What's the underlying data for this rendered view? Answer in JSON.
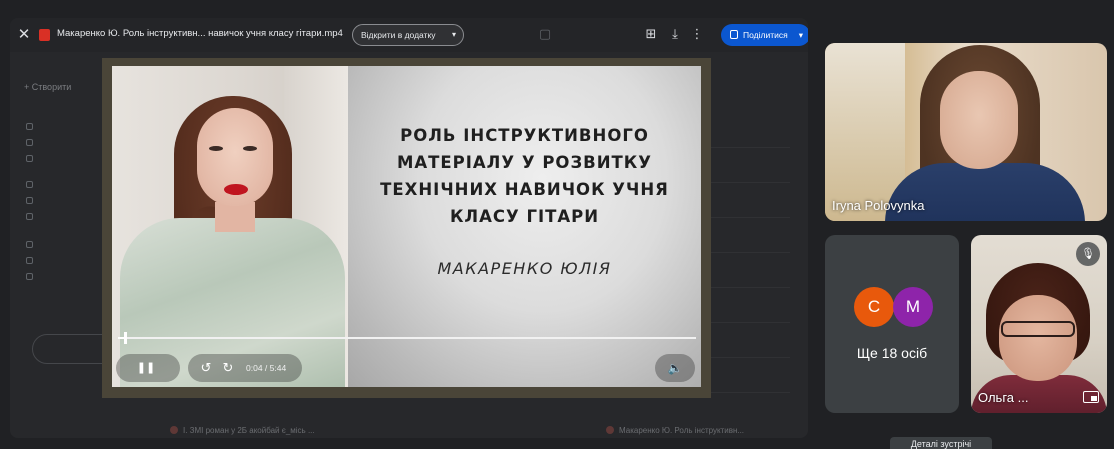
{
  "shared_screen": {
    "file_title": "Макаренко Ю. Роль інструктивн... навичок учня класу гітари.mp4",
    "open_with_label": "Відкрити в додатку",
    "share_button_label": "Поділитися",
    "drive_background": {
      "new_label": "+ Створити",
      "bottom_files": [
        "І. ЗМІ роман у 2Б акойбай є_місь ...",
        "Макаренко Ю. Роль інструктивн..."
      ]
    }
  },
  "video": {
    "slide_title_lines": [
      "РОЛЬ ІНСТРУКТИВНОГО",
      "МАТЕРІАЛУ У РОЗВИТКУ",
      "ТЕХНІЧНИХ НАВИЧОК УЧНЯ",
      "КЛАСУ ГІТАРИ"
    ],
    "slide_author": "МАКАРЕНКО ЮЛІЯ",
    "time_display": "0:04 / 5:44",
    "progress_fraction": 0.012
  },
  "participants": {
    "iryna": {
      "name": "Iryna Polovynka"
    },
    "olga": {
      "name": "Ольга ..."
    },
    "others": {
      "label": "Ще 18 осіб",
      "avatars": [
        {
          "letter": "С",
          "color": "#e8590c"
        },
        {
          "letter": "М",
          "color": "#8e24aa"
        }
      ]
    }
  },
  "tooltip": "Деталі зустрічі"
}
